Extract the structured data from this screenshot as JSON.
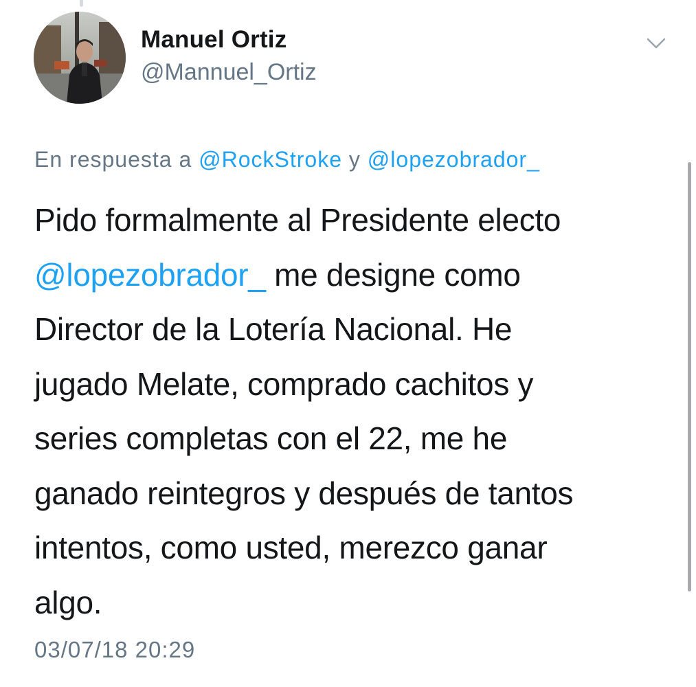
{
  "user": {
    "name": "Manuel Ortiz",
    "handle": "@Mannuel_Ortiz",
    "avatar_icon": "profile-photo"
  },
  "reply": {
    "prefix": "En respuesta a",
    "mention1": "@RockStroke",
    "conjunction": "y",
    "mention2": "@lopezobrador_"
  },
  "tweet": {
    "line1": "Pido formalmente al Presidente electo",
    "mention": "@lopezobrador_",
    "line2_rest": " me designe como",
    "line3": "Director de la Lotería Nacional. He",
    "line4": "jugado Melate, comprado cachitos y",
    "line5": "series completas con el 22, me he",
    "line6": "ganado reintegros y después de tantos",
    "line7": "intentos, como usted, merezco ganar",
    "line8": "algo."
  },
  "timestamp": "03/07/18 20:29",
  "colors": {
    "link": "#1da1f2",
    "secondary": "#657786",
    "text": "#14171a"
  },
  "icons": {
    "menu": "chevron-down-icon"
  }
}
